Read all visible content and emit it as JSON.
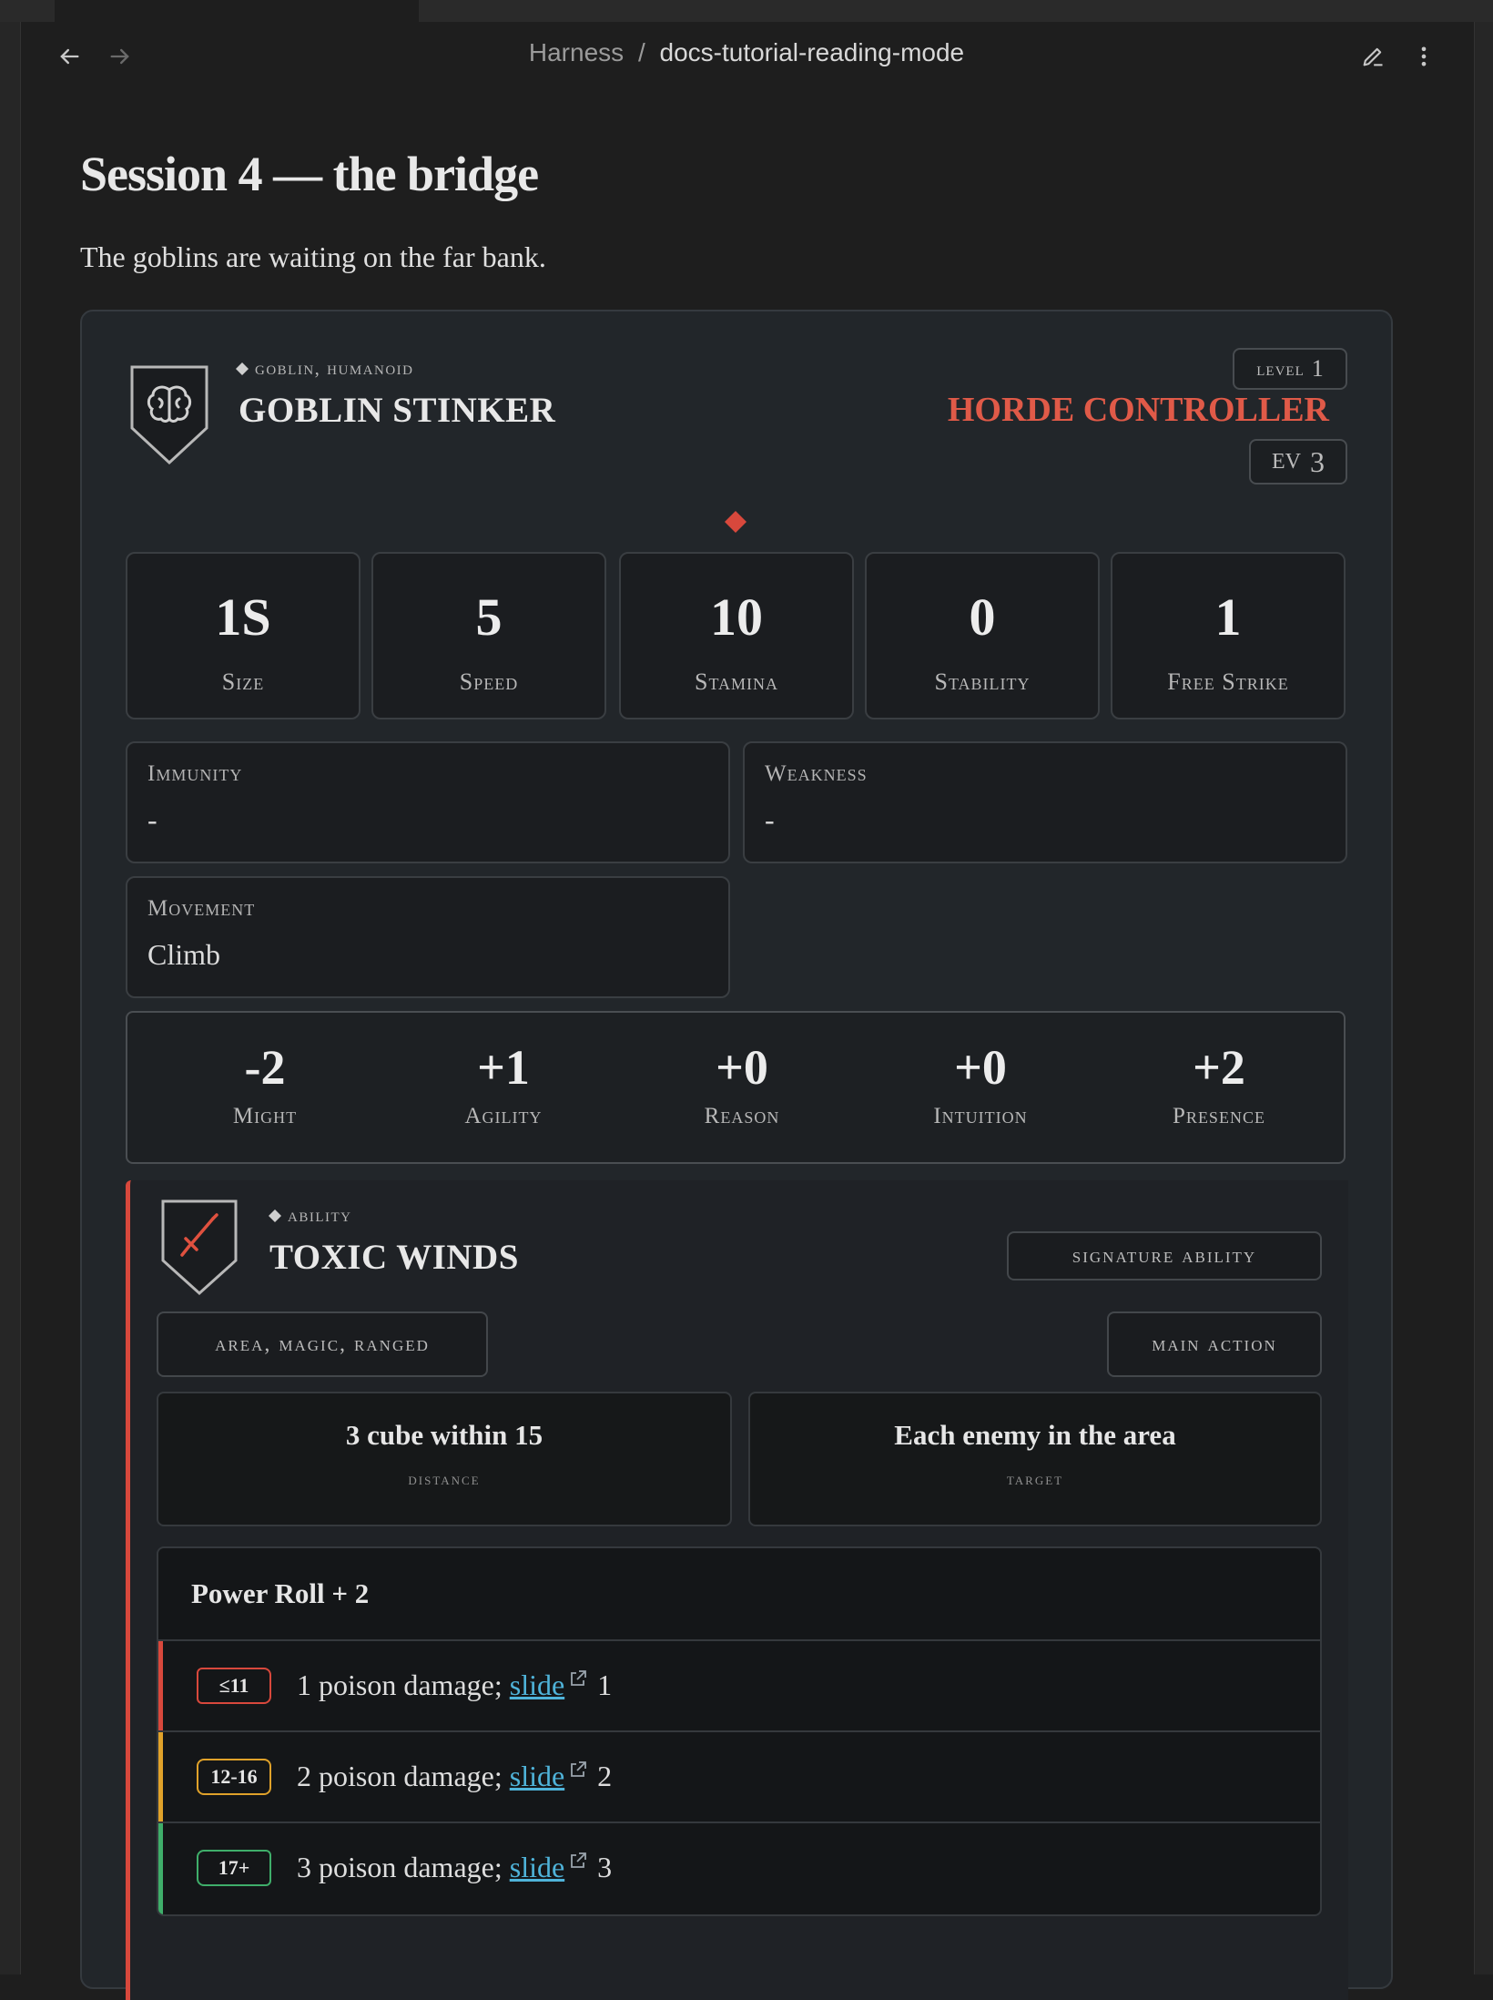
{
  "breadcrumb": {
    "parent": "Harness",
    "separator": "/",
    "current": "docs-tutorial-reading-mode"
  },
  "page": {
    "title": "Session 4 — the bridge",
    "subtitle": "The goblins are waiting on the far bank."
  },
  "monster": {
    "tags": "goblin, humanoid",
    "name": "GOBLIN STINKER",
    "level_label": "level",
    "level_value": "1",
    "role": "HORDE CONTROLLER",
    "ev_label": "EV",
    "ev_value": "3",
    "role_color": "#e05a48",
    "stats": [
      {
        "value": "1S",
        "label": "Size"
      },
      {
        "value": "5",
        "label": "Speed"
      },
      {
        "value": "10",
        "label": "Stamina"
      },
      {
        "value": "0",
        "label": "Stability"
      },
      {
        "value": "1",
        "label": "Free Strike"
      }
    ],
    "immunity": {
      "label": "Immunity",
      "value": "-"
    },
    "weakness": {
      "label": "Weakness",
      "value": "-"
    },
    "movement": {
      "label": "Movement",
      "value": "Climb"
    },
    "characteristics": [
      {
        "value": "-2",
        "label": "Might"
      },
      {
        "value": "+1",
        "label": "Agility"
      },
      {
        "value": "+0",
        "label": "Reason"
      },
      {
        "value": "+0",
        "label": "Intuition"
      },
      {
        "value": "+2",
        "label": "Presence"
      }
    ]
  },
  "ability": {
    "kind": "ability",
    "name": "TOXIC WINDS",
    "type_badge": "signature ability",
    "keywords": "area, magic, ranged",
    "action": "main action",
    "distance": {
      "value": "3 cube within 15",
      "label": "distance"
    },
    "target": {
      "value": "Each enemy in the area",
      "label": "target"
    },
    "power_roll": {
      "title": "Power Roll + 2",
      "tiers": [
        {
          "badge": "≤11",
          "pre": "1 poison damage; ",
          "link": "slide",
          "post": "1",
          "color": "#d8483c"
        },
        {
          "badge": "12-16",
          "pre": "2 poison damage; ",
          "link": "slide",
          "post": "2",
          "color": "#e0a22a"
        },
        {
          "badge": "17+",
          "pre": "3 poison damage; ",
          "link": "slide",
          "post": "3",
          "color": "#3fae6a"
        }
      ]
    }
  }
}
